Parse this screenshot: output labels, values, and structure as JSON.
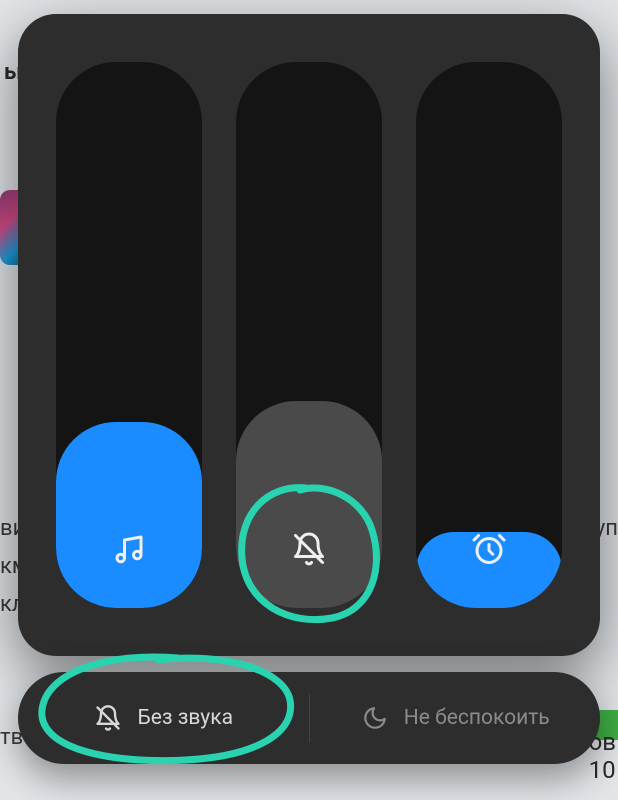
{
  "sliders": {
    "media": {
      "level_percent": 34,
      "icon": "music-note-icon",
      "fill_color": "#1a8cff"
    },
    "ring": {
      "level_percent": 38,
      "icon": "bell-off-icon",
      "fill_color": "#4a4a4a"
    },
    "alarm": {
      "level_percent": 14,
      "icon": "alarm-clock-icon",
      "fill_color": "#1a8cff"
    }
  },
  "toggles": {
    "mute": {
      "label": "Без звука",
      "icon": "bell-off-icon",
      "active": true
    },
    "dnd": {
      "label": "Не беспокоить",
      "icon": "moon-icon",
      "active": false
    }
  },
  "background": {
    "top_fragment": "ы",
    "left_lines_1": "ви",
    "left_lines_2": "км",
    "left_lines_3": "кл",
    "right_frag": "уп",
    "bottom_left": "тв",
    "bottom_right_1": "ов",
    "bottom_right_2": "10"
  },
  "colors": {
    "panel": "#2d2d2d",
    "slider_track": "#141414",
    "blue": "#1a8cff",
    "annotation": "#29d3b0"
  }
}
